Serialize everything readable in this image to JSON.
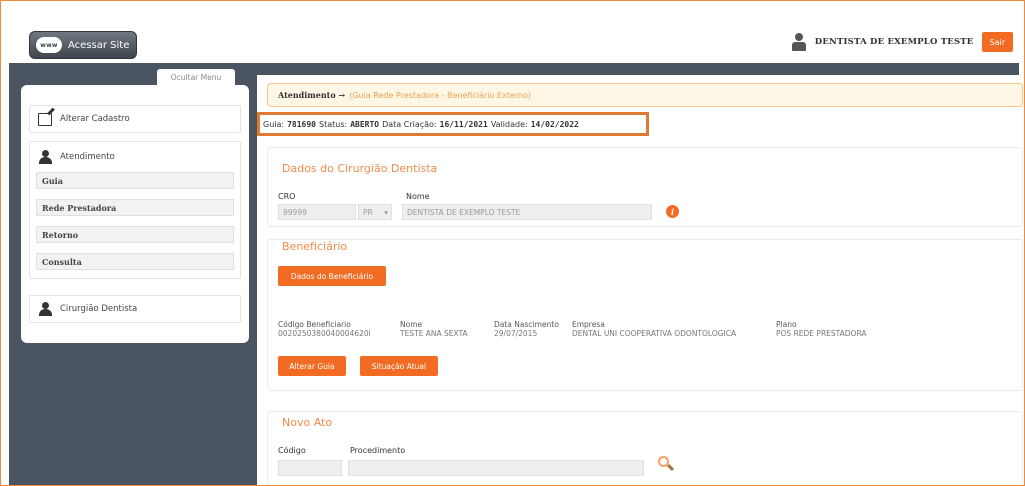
{
  "header": {
    "site_button_icon": "www",
    "site_button_label": "Acessar Site",
    "user_name": "DENTISTA DE EXEMPLO TESTE",
    "logout_label": "Sair"
  },
  "sidebar": {
    "hide_menu_label": "Ocultar Menu",
    "edit_profile_label": "Alterar Cadastro",
    "atendimento_label": "Atendimento",
    "atendimento_items": [
      {
        "label": "Guia"
      },
      {
        "label": "Rede Prestadora"
      },
      {
        "label": "Retorno"
      },
      {
        "label": "Consulta"
      }
    ],
    "dentist_label": "Cirurgião Dentista"
  },
  "breadcrumb": {
    "main": "Atendimento →",
    "sub": "(Guia Rede Prestadora - Beneficiário Externo)"
  },
  "guia": {
    "guia_label": "Guia:",
    "guia_value": "781690",
    "status_label": "Status:",
    "status_value": "ABERTO",
    "created_label": "Data Criação:",
    "created_value": "16/11/2021",
    "validity_label": "Validade:",
    "validity_value": "14/02/2022"
  },
  "dentist_section": {
    "title": "Dados do Cirurgião Dentista",
    "cro_label": "CRO",
    "cro_value": "99999",
    "uf_value": "PR",
    "uf_arrow": "▾",
    "name_label": "Nome",
    "name_value": "DENTISTA DE EXEMPLO TESTE",
    "info_glyph": "i"
  },
  "beneficiary_section": {
    "title": "Beneficiário",
    "data_button": "Dados do Beneficiário",
    "columns": [
      {
        "label": "Código Beneficiario",
        "value": "0020250380040004620l"
      },
      {
        "label": "Nome",
        "value": "TESTE ANA SEXTA"
      },
      {
        "label": "Data Nascimento",
        "value": "29/07/2015"
      },
      {
        "label": "Empresa",
        "value": "DENTAL UNI COOPERATIVA ODONTOLOGICA"
      },
      {
        "label": "Plano",
        "value": "POS REDE PRESTADORA"
      }
    ],
    "change_button": "Alterar Guia",
    "status_button": "Situação Atual"
  },
  "new_act_section": {
    "title": "Novo Ato",
    "code_label": "Código",
    "procedure_label": "Procedimento"
  },
  "colors": {
    "accent": "#f26b22",
    "sidebar_bg": "#4a5561",
    "highlight_border": "#e07a32",
    "section_title": "#f28b4a"
  }
}
